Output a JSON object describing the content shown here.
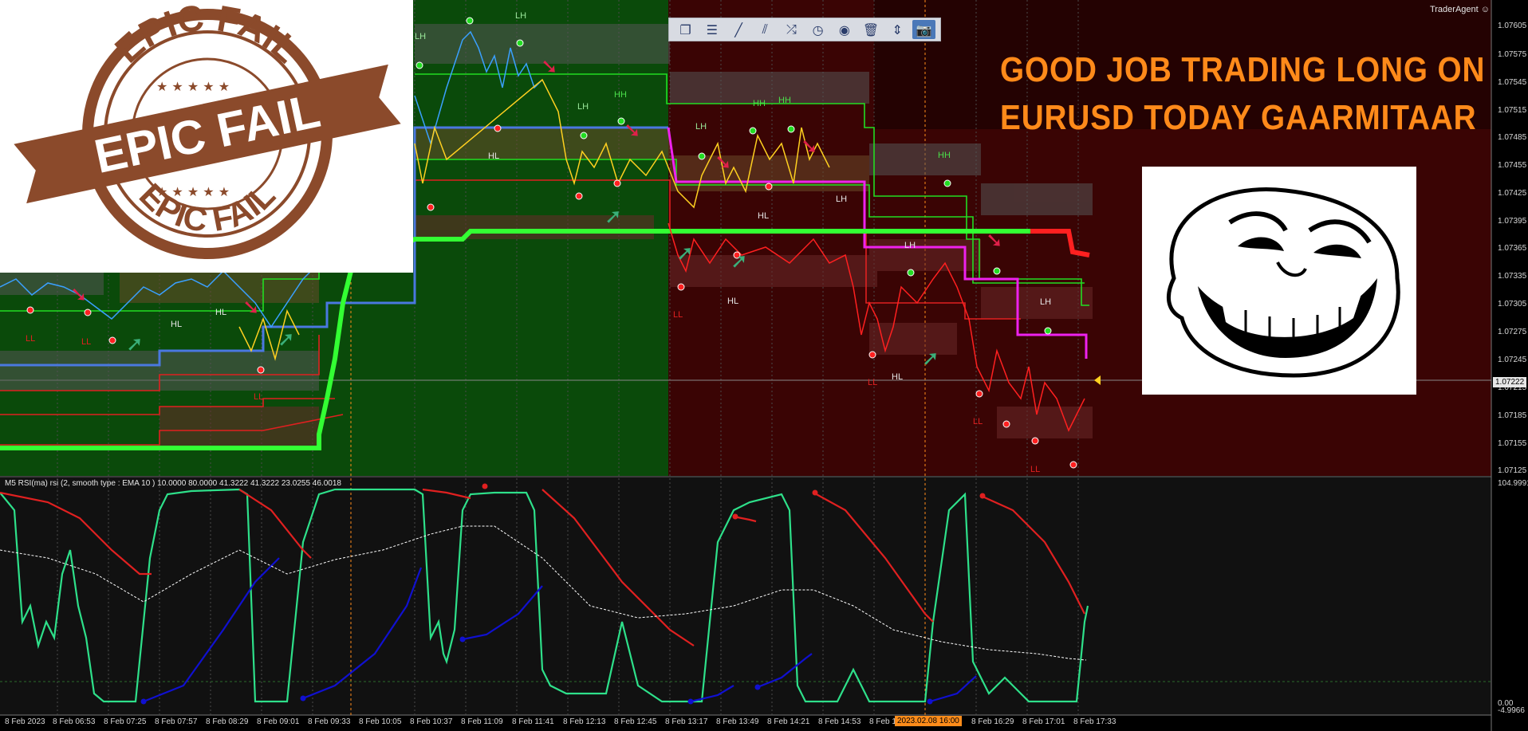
{
  "app": {
    "brand": "TraderAgent"
  },
  "headline": {
    "line1": "GOOD JOB TRADING LONG ON",
    "line2": "EURUSD TODAY GAARMITAAR"
  },
  "stamp": {
    "top": "EPIC FAIL",
    "center": "EPIC FAIL",
    "bottom": "EPIC FAIL"
  },
  "toolbar": {
    "buttons": [
      {
        "name": "windows-icon",
        "glyph": "❐"
      },
      {
        "name": "menu-icon",
        "glyph": "☰"
      },
      {
        "name": "line-tool-icon",
        "glyph": "╱"
      },
      {
        "name": "channel-tool-icon",
        "glyph": "⫽"
      },
      {
        "name": "shuffle-icon",
        "glyph": "⤮"
      },
      {
        "name": "clock-icon",
        "glyph": "◷"
      },
      {
        "name": "eye-icon",
        "glyph": "◉"
      },
      {
        "name": "trash-icon",
        "glyph": "🗑"
      },
      {
        "name": "split-icon",
        "glyph": "⇕"
      },
      {
        "name": "camera-icon",
        "glyph": "📷"
      }
    ]
  },
  "rsi_panel": {
    "label": "M5 RSI(ma) rsi (2, smooth type : EMA  10 ) 10.0000 80.0000 41.3222 41.3222 23.0255 46.0018"
  },
  "price_axis": {
    "labels": [
      "1.07605",
      "1.07575",
      "1.07545",
      "1.07515",
      "1.07485",
      "1.07455",
      "1.07425",
      "1.07395",
      "1.07365",
      "1.07335",
      "1.07305",
      "1.07275",
      "1.07245",
      "1.07215",
      "1.07185",
      "1.07155",
      "1.07125"
    ],
    "current": "1.07222",
    "rsi_max": "104.9991",
    "rsi_zero": "0.00",
    "rsi_min": "-4.9966"
  },
  "time_axis": {
    "labels": [
      "8 Feb 2023",
      "8 Feb 06:53",
      "8 Feb 07:25",
      "8 Feb 07:57",
      "8 Feb 08:29",
      "8 Feb 09:01",
      "8 Feb 09:33",
      "8 Feb 10:05",
      "8 Feb 10:37",
      "8 Feb 11:09",
      "8 Feb 11:41",
      "8 Feb 12:13",
      "8 Feb 12:45",
      "8 Feb 13:17",
      "8 Feb 13:49",
      "8 Feb 14:21",
      "8 Feb 14:53",
      "8 Feb 1",
      "8 Feb 16:29",
      "8 Feb 17:01",
      "8 Feb 17:33"
    ],
    "highlight": "2023.02.08 16:00"
  },
  "structure_labels": {
    "lh": "LH",
    "hh": "HH",
    "hl": "HL",
    "ll": "LL"
  },
  "colors": {
    "bull_bg": "#0a4a0a",
    "bear_bg": "#3a0404",
    "headline": "#ff8a1a",
    "rsi_green": "#2ee08a",
    "rsi_red": "#e02020",
    "rsi_blue": "#1010d0",
    "stamp": "#8b4a2b"
  }
}
